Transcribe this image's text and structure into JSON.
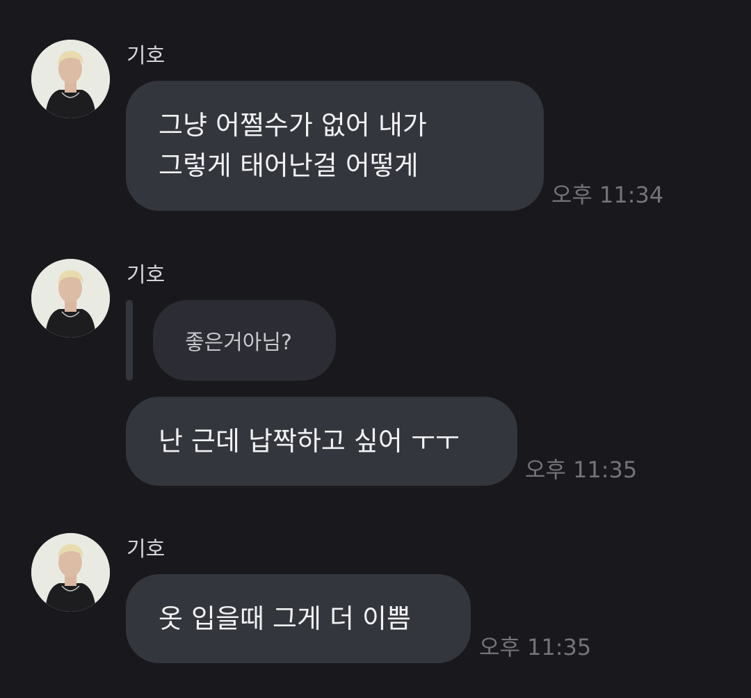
{
  "colors": {
    "background": "#18181d",
    "bubble": "#34363d",
    "quote_bubble": "#2c2d34",
    "text": "#f2f2f4",
    "timestamp": "#74747a"
  },
  "messages": [
    {
      "sender": "기호",
      "avatar_icon": "profile-photo-icon",
      "lines": [
        "그냥 어쩔수가 없어 내가",
        "그렇게 태어난걸 어떻게"
      ],
      "time": "오후 11:34"
    },
    {
      "sender": "기호",
      "avatar_icon": "profile-photo-icon",
      "quoted": "좋은거아님?",
      "lines": [
        "난 근데 납짝하고 싶어 ㅜㅜ"
      ],
      "time": "오후 11:35"
    },
    {
      "sender": "기호",
      "avatar_icon": "profile-photo-icon",
      "lines": [
        "옷 입을때 그게 더 이쁨"
      ],
      "time": "오후 11:35"
    }
  ]
}
